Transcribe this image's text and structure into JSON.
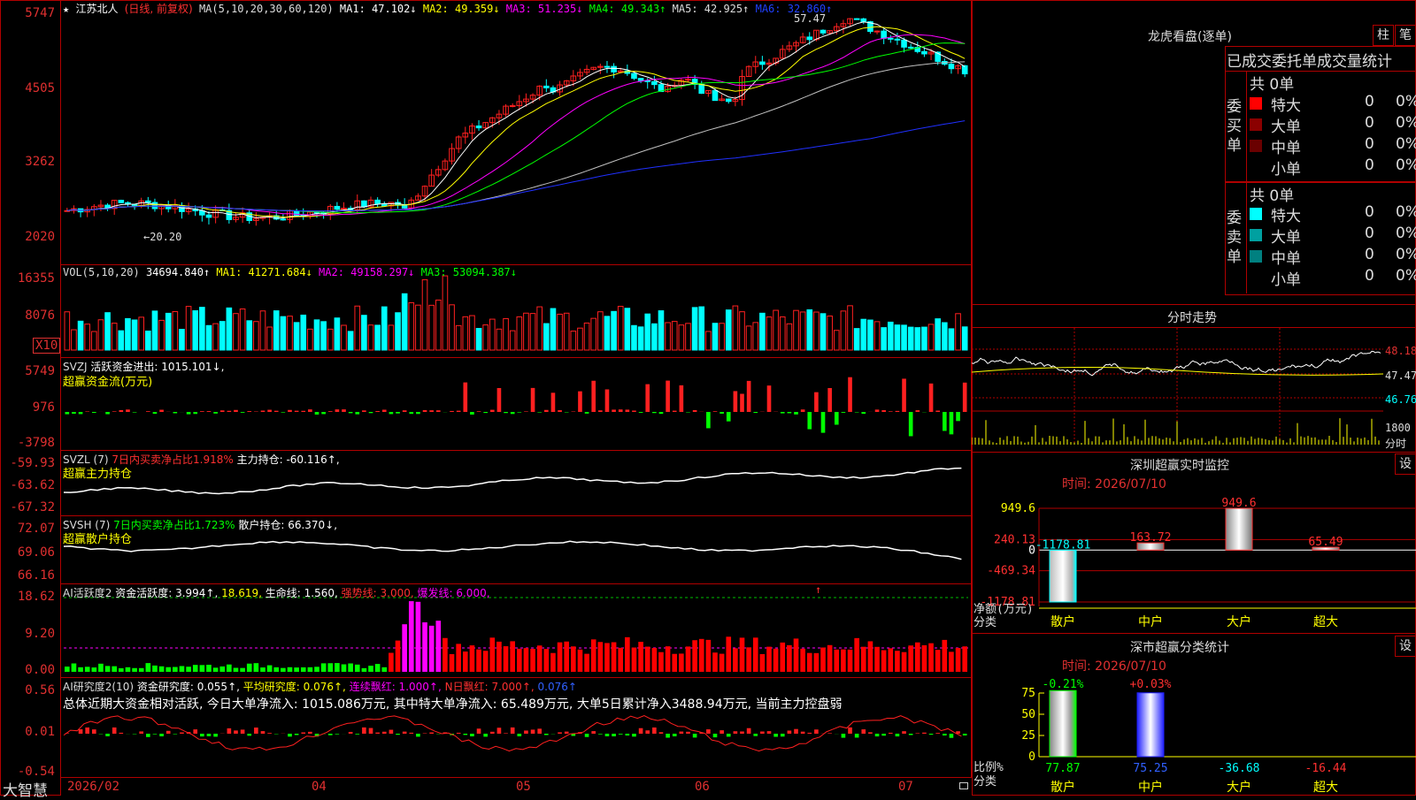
{
  "app": {
    "name": "大智慧"
  },
  "main_header": {
    "star": "★",
    "stock_name": "江苏北人",
    "period": "(日线, 前复权)",
    "ma_label": "MA(5,10,20,30,60,120)",
    "ma1": "MA1: 47.102↓",
    "ma2": "MA2: 49.359↓",
    "ma3": "MA3: 51.235↓",
    "ma4": "MA4: 49.343↑",
    "ma5": "MA5: 42.925↑",
    "ma6": "MA6: 32.860↑",
    "high_mark": "57.47",
    "low_mark": "←20.20"
  },
  "colors": {
    "up": "#ff2020",
    "down": "#00ffff",
    "grid": "#b00000",
    "ma1": "#ffffff",
    "ma2": "#ffff00",
    "ma3": "#ff00ff",
    "ma4": "#00ff00",
    "ma5": "#c0c0c0",
    "ma6": "#2030ff"
  },
  "price_axis": [
    "5747",
    "4505",
    "3262",
    "2020"
  ],
  "vol_header": {
    "label": "VOL(5,10,20)",
    "value": "34694.840↑",
    "ma1": "MA1: 41271.684↓",
    "ma2": "MA2: 49158.297↓",
    "ma3": "MA3: 53094.387↓"
  },
  "vol_axis": [
    "16355",
    "8076"
  ],
  "vol_unit": "X10",
  "svzj_header": {
    "label": "SVZJ",
    "text": "活跃资金进出: 1015.101↓,",
    "sub": "超赢资金流(万元)"
  },
  "svzj_axis": [
    "5749",
    "976",
    "-3798"
  ],
  "svzl_header": {
    "label": "SVZL (7)",
    "ratio": "7日内买卖净占比1.918%",
    "hold": "主力持仓: -60.116↑,",
    "sub": "超赢主力持仓"
  },
  "svzl_axis": [
    "-59.93",
    "-63.62",
    "-67.32"
  ],
  "svsh_header": {
    "label": "SVSH (7)",
    "ratio": "7日内买卖净占比1.723%",
    "hold": "散户持仓: 66.370↓,",
    "sub": "超赢散户持仓"
  },
  "svsh_axis": [
    "72.07",
    "69.06",
    "66.16"
  ],
  "ai2_header": {
    "label": "AI活跃度2",
    "a": "资金活跃度: 3.994↑,",
    "b": "18.619,",
    "c": "生命线: 1.560,",
    "d": "强势线: 3.000,",
    "e": "爆发线: 6.000,",
    "f": "↑"
  },
  "ai2_axis": [
    "18.62",
    "9.20",
    "0.00"
  ],
  "ai3_header": {
    "label": "AI研究度2(10)",
    "a": "资金研究度: 0.055↑,",
    "b": "平均研究度: 0.076↑,",
    "c": "连续飘红: 1.000↑,",
    "d": "N日飘红: 7.000↑,",
    "e": "0.076↑"
  },
  "ai3_summary": "总体近期大资金相对活跃, 今日大单净流入: 1015.086万元, 其中特大单净流入: 65.489万元, 大单5日累计净入3488.94万元, 当前主力控盘弱",
  "ai3_axis": [
    "0.56",
    "0.01",
    "-0.54"
  ],
  "date_axis": [
    "2026/02",
    "04",
    "05",
    "06",
    "07"
  ],
  "longhu": {
    "title": "龙虎看盘(逐单)",
    "btn_zhu": "柱",
    "btn_bi": "笔",
    "subtitle": "已成交委托单成交量统计",
    "buy_label": "委买单",
    "sell_label": "委卖单",
    "buy_total": "共 0单",
    "sell_total": "共 0单",
    "buy_rows": [
      {
        "name": "特大",
        "vol": "0",
        "pct": "0%",
        "color": "#ff0000"
      },
      {
        "name": "大单",
        "vol": "0",
        "pct": "0%",
        "color": "#8b0000"
      },
      {
        "name": "中单",
        "vol": "0",
        "pct": "0%",
        "color": "#6a0000"
      },
      {
        "name": "小单",
        "vol": "0",
        "pct": "0%",
        "color": ""
      }
    ],
    "sell_rows": [
      {
        "name": "特大",
        "vol": "0",
        "pct": "0%",
        "color": "#00ffff"
      },
      {
        "name": "大单",
        "vol": "0",
        "pct": "0%",
        "color": "#00a0a0"
      },
      {
        "name": "中单",
        "vol": "0",
        "pct": "0%",
        "color": "#008080"
      },
      {
        "name": "小单",
        "vol": "0",
        "pct": "0%",
        "color": ""
      }
    ]
  },
  "intraday": {
    "title": "分时走势",
    "prices": [
      "48.18",
      "47.47",
      "46.76"
    ],
    "volume": "1800",
    "sub": "分时"
  },
  "realtime": {
    "title": "深圳超赢实时监控",
    "btn": "设",
    "time": "时间: 2026/07/10",
    "axis": [
      "949.6",
      "240.13",
      "0",
      "-469.34",
      "-1178.81"
    ],
    "ylabel": "净额(万元)",
    "xlabel": "分类",
    "categories": [
      "散户",
      "中户",
      "大户",
      "超大"
    ],
    "values": [
      -1178.81,
      163.72,
      949.6,
      65.49
    ],
    "value_labels": [
      "-1178.81",
      "163.72",
      "949.6",
      "65.49"
    ]
  },
  "classify": {
    "title": "深市超赢分类统计",
    "btn": "设",
    "time": "时间: 2026/07/10",
    "axis": [
      "75",
      "50",
      "25",
      "0"
    ],
    "ylabel": "比例%",
    "xlabel": "分类",
    "top_labels": [
      "-0.21%",
      "+0.03%"
    ],
    "categories": [
      "散户",
      "中户",
      "大户",
      "超大"
    ],
    "values": [
      77.87,
      75.25,
      -36.68,
      -16.44
    ],
    "value_labels": [
      "77.87",
      "75.25",
      "-36.68",
      "-16.44"
    ]
  },
  "chart_data": [
    {
      "type": "bar",
      "title": "深圳超赢实时监控",
      "ylabel": "净额(万元)",
      "categories": [
        "散户",
        "中户",
        "大户",
        "超大"
      ],
      "values": [
        -1178.81,
        163.72,
        949.6,
        65.49
      ],
      "ylim": [
        -1178.81,
        949.6
      ]
    },
    {
      "type": "bar",
      "title": "深市超赢分类统计",
      "ylabel": "比例%",
      "categories": [
        "散户",
        "中户",
        "大户",
        "超大"
      ],
      "values": [
        77.87,
        75.25,
        -36.68,
        -16.44
      ],
      "ylim": [
        0,
        75
      ]
    }
  ]
}
